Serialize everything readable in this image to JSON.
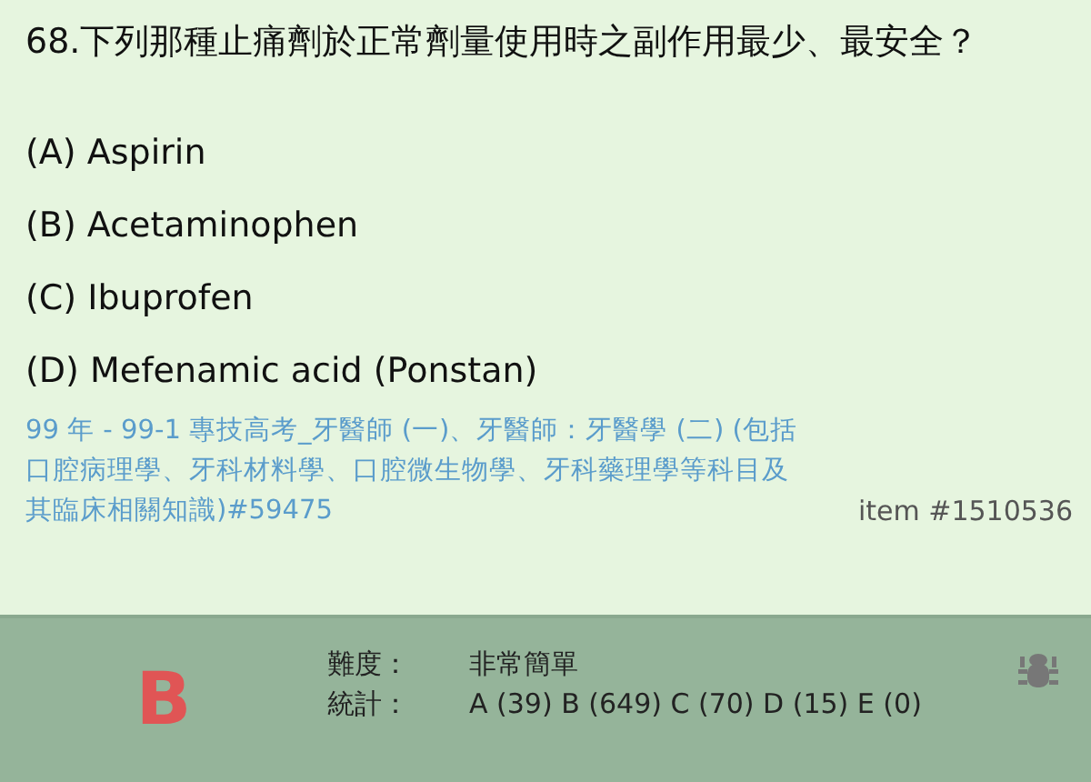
{
  "question": "68.下列那種止痛劑於正常劑量使用時之副作用最少、最安全？",
  "options": [
    "(A) Aspirin",
    "(B) Acetaminophen",
    "(C) Ibuprofen",
    "(D) Mefenamic acid (Ponstan)"
  ],
  "source": "99 年 - 99-1 專技高考_牙醫師 (一)、牙醫師：牙醫學 (二) (包括口腔病理學、牙科材料學、口腔微生物學、牙科藥理學等科目及其臨床相關知識)#59475",
  "item_id": "item #1510536",
  "answer": "B",
  "details": [
    {
      "label": "難度：",
      "value": "非常簡單"
    },
    {
      "label": "統計：",
      "value": "A (39)  B (649)  C (70)  D (15)  E (0)"
    }
  ]
}
